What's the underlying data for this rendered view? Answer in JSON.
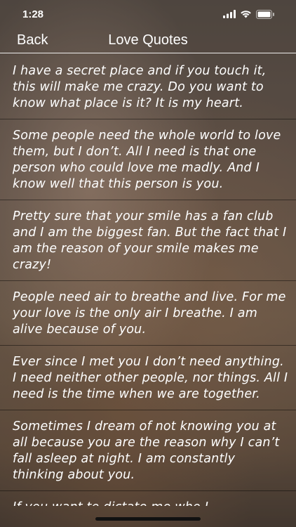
{
  "status": {
    "time": "1:28"
  },
  "nav": {
    "back_label": "Back",
    "title": "Love Quotes"
  },
  "quotes": [
    "I have a secret place and if you touch it, this will make me crazy. Do you want to know what place is it? It is my heart.",
    "Some people need the whole world to love them, but I don’t. All I need is that one person who could love me madly. And I know well that this person is you.",
    "Pretty sure that your smile has a fan club and I am the biggest fan. But the fact that I am the reason of your smile makes me crazy!",
    "People need air to breathe and live. For me your love is the only air I breathe. I am alive because of you.",
    "Ever since I met you I don’t need anything. I need neither other people, nor things. All I need is the time when we are together.",
    "Sometimes I dream of not knowing you at all because you are the reason why I can’t fall asleep at night. I am constantly thinking about you.",
    "If you want to dictate me who I"
  ]
}
